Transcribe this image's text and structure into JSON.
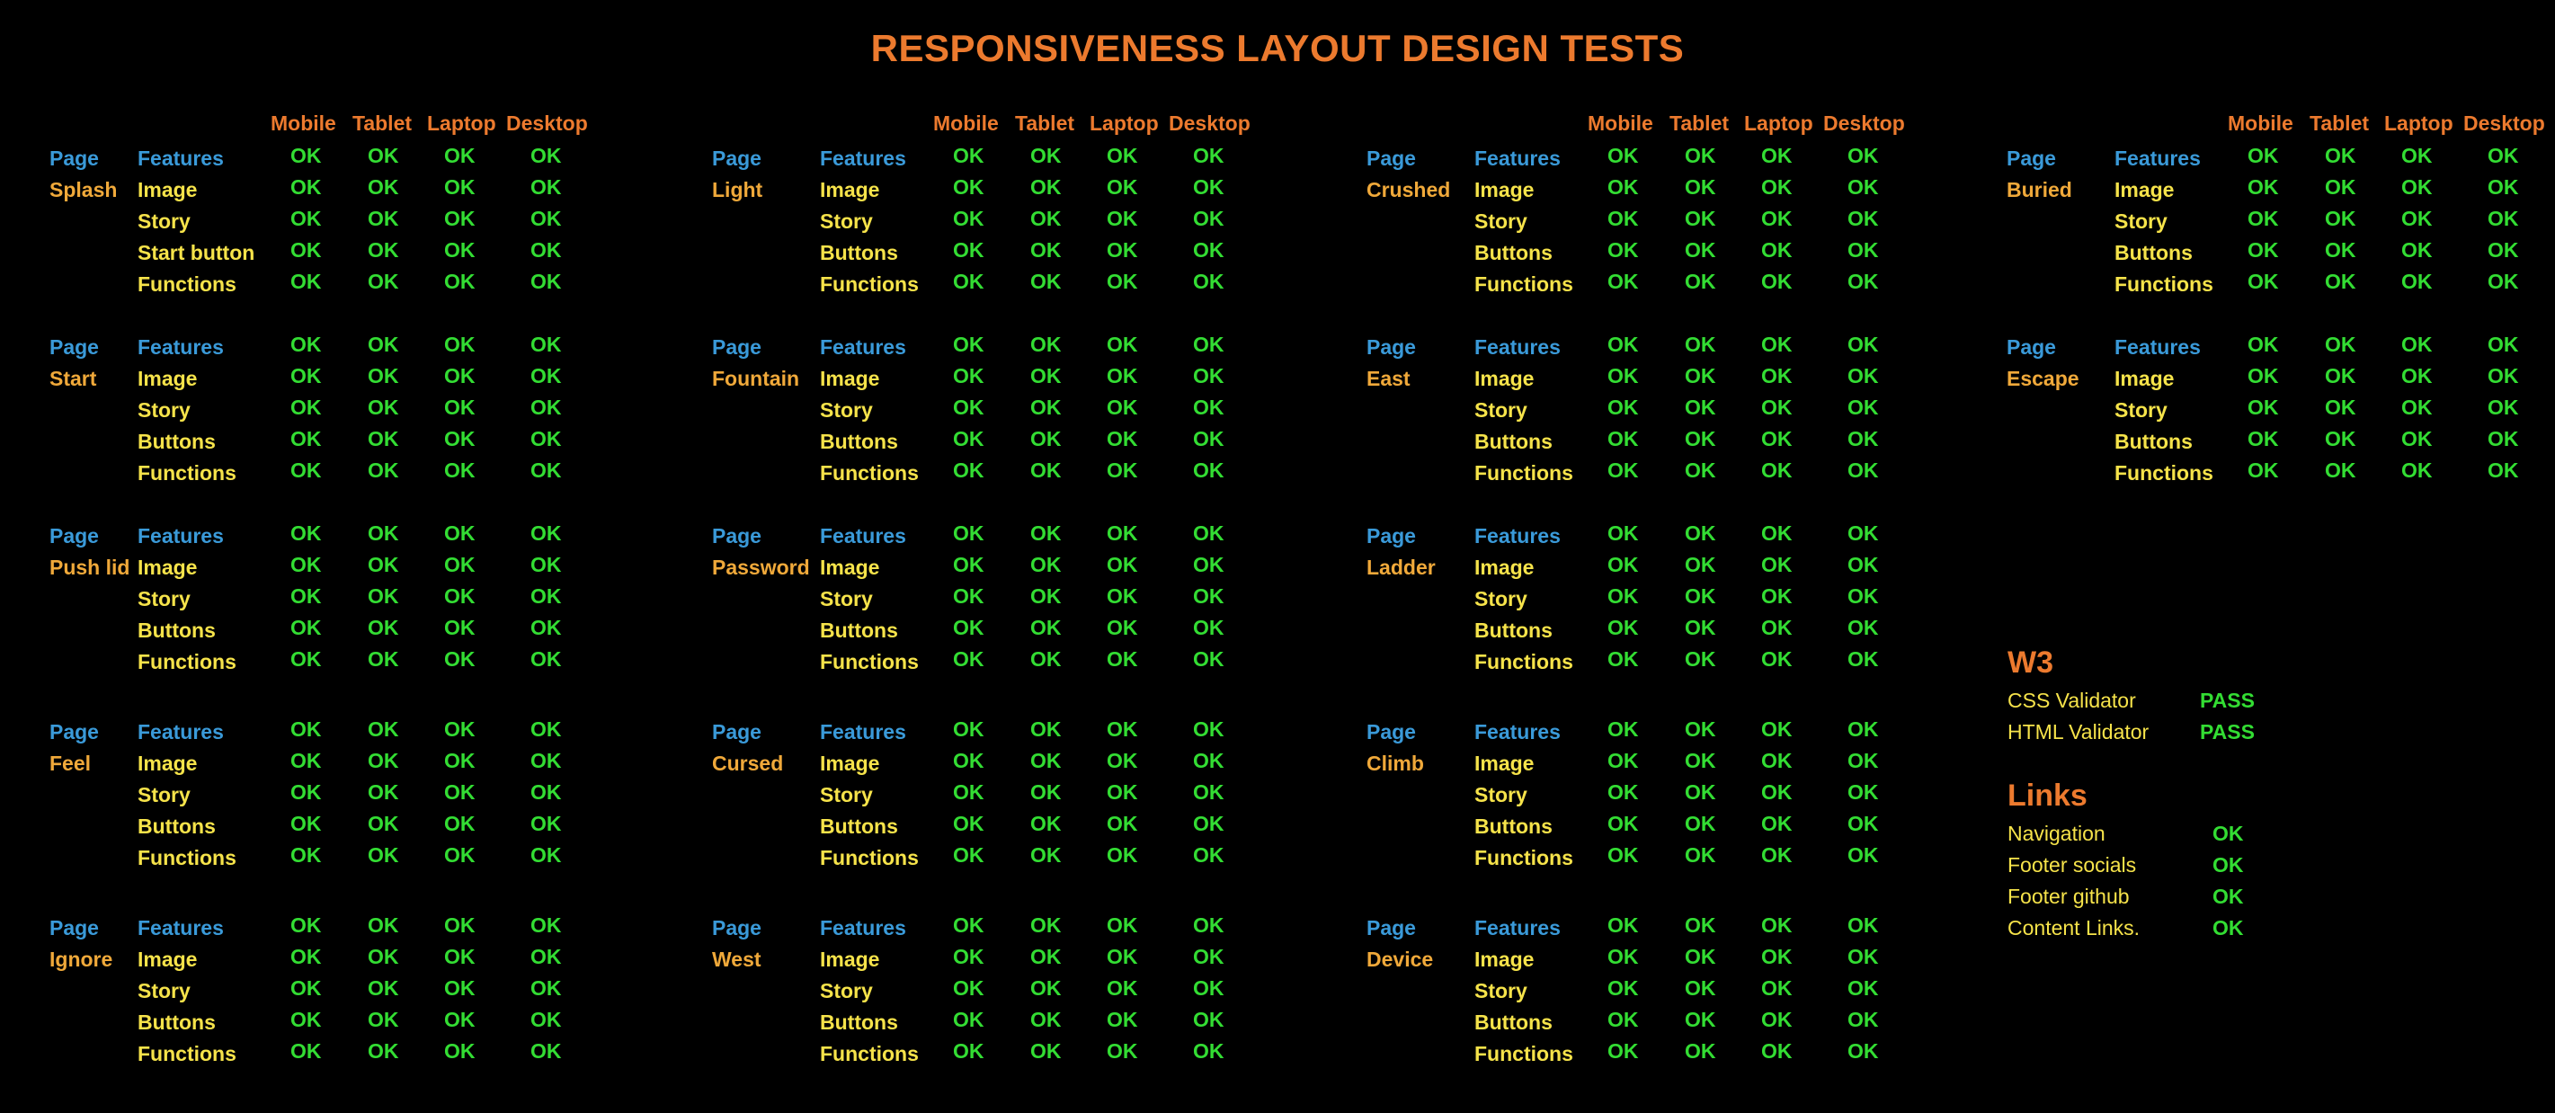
{
  "title": "RESPONSIVENESS LAYOUT DESIGN TESTS",
  "devices": [
    "Mobile",
    "Tablet",
    "Laptop",
    "Desktop"
  ],
  "page_label": "Page",
  "features_label": "Features",
  "ok": "OK",
  "columns": [
    {
      "blocks": [
        {
          "name": "Splash",
          "items": [
            "Image",
            "Story",
            "Start button",
            "Functions"
          ]
        },
        {
          "name": "Start",
          "items": [
            "Image",
            "Story",
            "Buttons",
            "Functions"
          ]
        },
        {
          "name": "Push lid",
          "items": [
            "Image",
            "Story",
            "Buttons",
            "Functions"
          ]
        },
        {
          "name": "Feel",
          "items": [
            "Image",
            "Story",
            "Buttons",
            "Functions"
          ]
        },
        {
          "name": "Ignore",
          "items": [
            "Image",
            "Story",
            "Buttons",
            "Functions"
          ]
        }
      ]
    },
    {
      "blocks": [
        {
          "name": "Light",
          "items": [
            "Image",
            "Story",
            "Buttons",
            "Functions"
          ]
        },
        {
          "name": "Fountain",
          "items": [
            "Image",
            "Story",
            "Buttons",
            "Functions"
          ]
        },
        {
          "name": "Password",
          "items": [
            "Image",
            "Story",
            "Buttons",
            "Functions"
          ]
        },
        {
          "name": "Cursed",
          "items": [
            "Image",
            "Story",
            "Buttons",
            "Functions"
          ]
        },
        {
          "name": "West",
          "items": [
            "Image",
            "Story",
            "Buttons",
            "Functions"
          ]
        }
      ]
    },
    {
      "blocks": [
        {
          "name": "Crushed",
          "items": [
            "Image",
            "Story",
            "Buttons",
            "Functions"
          ]
        },
        {
          "name": "East",
          "items": [
            "Image",
            "Story",
            "Buttons",
            "Functions"
          ]
        },
        {
          "name": "Ladder",
          "items": [
            "Image",
            "Story",
            "Buttons",
            "Functions"
          ]
        },
        {
          "name": "Climb",
          "items": [
            "Image",
            "Story",
            "Buttons",
            "Functions"
          ]
        },
        {
          "name": "Device",
          "items": [
            "Image",
            "Story",
            "Buttons",
            "Functions"
          ]
        }
      ]
    },
    {
      "blocks": [
        {
          "name": "Buried",
          "items": [
            "Image",
            "Story",
            "Buttons",
            "Functions"
          ]
        },
        {
          "name": "Escape",
          "items": [
            "Image",
            "Story",
            "Buttons",
            "Functions"
          ]
        }
      ]
    }
  ],
  "w3": {
    "title": "W3",
    "rows": [
      {
        "label": "CSS Validator",
        "value": "PASS"
      },
      {
        "label": "HTML Validator",
        "value": "PASS"
      }
    ]
  },
  "links": {
    "title": "Links",
    "rows": [
      {
        "label": "Navigation",
        "value": "OK"
      },
      {
        "label": "Footer socials",
        "value": "OK"
      },
      {
        "label": "Footer github",
        "value": "OK"
      },
      {
        "label": "Content Links.",
        "value": "OK"
      }
    ]
  },
  "colors": {
    "background": "#000000",
    "heading": "#ec7a2e",
    "page_label": "#3a9ad9",
    "page_name": "#f0a93a",
    "feature": "#f6e34a",
    "ok": "#33dd33"
  }
}
